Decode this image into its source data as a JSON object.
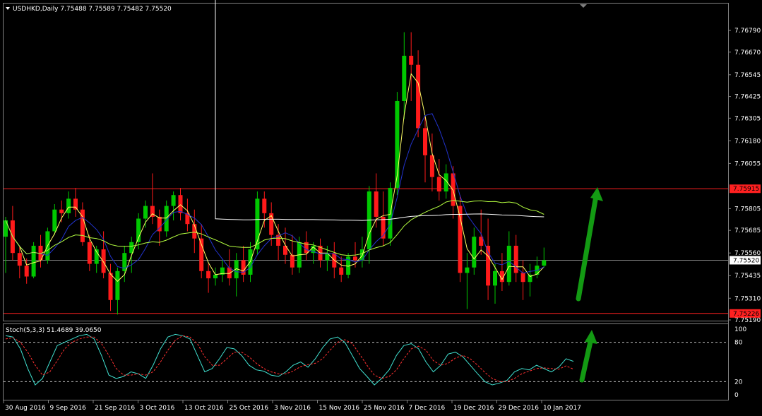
{
  "header": {
    "symbol_line": "USDHKD,Daily  7.75488 7.75589 7.75482 7.75520"
  },
  "indicator": {
    "label": "Stoch(5,3,3) 51.4689 39.0650"
  },
  "colors": {
    "background": "#000000",
    "grid": "#808080",
    "bull": "#00c800",
    "bear": "#ff1a1a",
    "ma_fast": "#ffff66",
    "ma_mid": "#2233cc",
    "ma_slow": "#b5ff40",
    "ma_long": "#ffffff",
    "stoch_main": "#40e0d0",
    "stoch_signal": "#ff3030",
    "hline": "#ff2020",
    "arrow": "#139a13"
  },
  "chart_data": {
    "type": "candlestick",
    "ylim": [
      7.7519,
      7.7688
    ],
    "y_ticks": [
      "7.76790",
      "7.76670",
      "7.76545",
      "7.76425",
      "7.76305",
      "7.76180",
      "7.76055",
      "7.75805",
      "7.75685",
      "7.75560",
      "7.75435",
      "7.75310",
      "7.75190"
    ],
    "price_labels": [
      {
        "value": 7.75915,
        "text": "7.75915",
        "style": "red"
      },
      {
        "value": 7.7552,
        "text": "7.75520",
        "style": "white"
      },
      {
        "value": 7.75226,
        "text": "7.75226",
        "style": "red"
      }
    ],
    "horizontal_lines": [
      7.75915,
      7.75226
    ],
    "current_price_line": 7.7552,
    "x_labels": [
      "30 Aug 2016",
      "9 Sep 2016",
      "21 Sep 2016",
      "3 Oct 2016",
      "13 Oct 2016",
      "25 Oct 2016",
      "3 Nov 2016",
      "15 Nov 2016",
      "25 Nov 2016",
      "7 Dec 2016",
      "19 Dec 2016",
      "29 Dec 2016",
      "10 Jan 2017"
    ],
    "candles": [
      {
        "o": 7.7565,
        "h": 7.7576,
        "l": 7.7545,
        "c": 7.7574
      },
      {
        "o": 7.7574,
        "h": 7.7582,
        "l": 7.7552,
        "c": 7.7556
      },
      {
        "o": 7.7556,
        "h": 7.756,
        "l": 7.7542,
        "c": 7.7549
      },
      {
        "o": 7.7549,
        "h": 7.7553,
        "l": 7.7539,
        "c": 7.7543
      },
      {
        "o": 7.7543,
        "h": 7.7562,
        "l": 7.7542,
        "c": 7.756
      },
      {
        "o": 7.756,
        "h": 7.7566,
        "l": 7.7548,
        "c": 7.7552
      },
      {
        "o": 7.7552,
        "h": 7.757,
        "l": 7.755,
        "c": 7.7568
      },
      {
        "o": 7.7568,
        "h": 7.7583,
        "l": 7.7566,
        "c": 7.758
      },
      {
        "o": 7.758,
        "h": 7.7585,
        "l": 7.7573,
        "c": 7.7578
      },
      {
        "o": 7.7578,
        "h": 7.759,
        "l": 7.7575,
        "c": 7.7586
      },
      {
        "o": 7.7586,
        "h": 7.7592,
        "l": 7.7576,
        "c": 7.758
      },
      {
        "o": 7.758,
        "h": 7.7584,
        "l": 7.756,
        "c": 7.7562
      },
      {
        "o": 7.7562,
        "h": 7.7566,
        "l": 7.7546,
        "c": 7.755
      },
      {
        "o": 7.755,
        "h": 7.756,
        "l": 7.7545,
        "c": 7.7558
      },
      {
        "o": 7.7558,
        "h": 7.7568,
        "l": 7.7542,
        "c": 7.7545
      },
      {
        "o": 7.7545,
        "h": 7.755,
        "l": 7.7524,
        "c": 7.753
      },
      {
        "o": 7.753,
        "h": 7.7548,
        "l": 7.7522,
        "c": 7.7546
      },
      {
        "o": 7.7546,
        "h": 7.756,
        "l": 7.754,
        "c": 7.7556
      },
      {
        "o": 7.7556,
        "h": 7.7565,
        "l": 7.7545,
        "c": 7.7562
      },
      {
        "o": 7.7562,
        "h": 7.7578,
        "l": 7.7558,
        "c": 7.7575
      },
      {
        "o": 7.7575,
        "h": 7.7585,
        "l": 7.757,
        "c": 7.7582
      },
      {
        "o": 7.7582,
        "h": 7.76,
        "l": 7.7572,
        "c": 7.7576
      },
      {
        "o": 7.7576,
        "h": 7.758,
        "l": 7.756,
        "c": 7.7568
      },
      {
        "o": 7.7568,
        "h": 7.7585,
        "l": 7.7565,
        "c": 7.7582
      },
      {
        "o": 7.7582,
        "h": 7.759,
        "l": 7.7574,
        "c": 7.7588
      },
      {
        "o": 7.7588,
        "h": 7.7592,
        "l": 7.7574,
        "c": 7.7578
      },
      {
        "o": 7.7578,
        "h": 7.7586,
        "l": 7.7568,
        "c": 7.7572
      },
      {
        "o": 7.7572,
        "h": 7.758,
        "l": 7.7556,
        "c": 7.7564
      },
      {
        "o": 7.7564,
        "h": 7.7572,
        "l": 7.7542,
        "c": 7.7546
      },
      {
        "o": 7.7546,
        "h": 7.755,
        "l": 7.7534,
        "c": 7.7542
      },
      {
        "o": 7.7542,
        "h": 7.7548,
        "l": 7.7538,
        "c": 7.7544
      },
      {
        "o": 7.7544,
        "h": 7.7552,
        "l": 7.754,
        "c": 7.7548
      },
      {
        "o": 7.7548,
        "h": 7.7558,
        "l": 7.7538,
        "c": 7.7542
      },
      {
        "o": 7.7542,
        "h": 7.7556,
        "l": 7.7532,
        "c": 7.7552
      },
      {
        "o": 7.7552,
        "h": 7.756,
        "l": 7.754,
        "c": 7.7544
      },
      {
        "o": 7.7544,
        "h": 7.7562,
        "l": 7.754,
        "c": 7.7558
      },
      {
        "o": 7.7558,
        "h": 7.759,
        "l": 7.7555,
        "c": 7.7586
      },
      {
        "o": 7.7586,
        "h": 7.759,
        "l": 7.757,
        "c": 7.7578
      },
      {
        "o": 7.7578,
        "h": 7.7584,
        "l": 7.756,
        "c": 7.7566
      },
      {
        "o": 7.7566,
        "h": 7.7572,
        "l": 7.7552,
        "c": 7.756
      },
      {
        "o": 7.756,
        "h": 7.757,
        "l": 7.755,
        "c": 7.7555
      },
      {
        "o": 7.7555,
        "h": 7.7566,
        "l": 7.7544,
        "c": 7.7548
      },
      {
        "o": 7.7548,
        "h": 7.7565,
        "l": 7.7545,
        "c": 7.7562
      },
      {
        "o": 7.7562,
        "h": 7.7568,
        "l": 7.7552,
        "c": 7.7556
      },
      {
        "o": 7.7556,
        "h": 7.7562,
        "l": 7.755,
        "c": 7.756
      },
      {
        "o": 7.756,
        "h": 7.7564,
        "l": 7.7548,
        "c": 7.7552
      },
      {
        "o": 7.7552,
        "h": 7.756,
        "l": 7.7546,
        "c": 7.7556
      },
      {
        "o": 7.7556,
        "h": 7.7562,
        "l": 7.7542,
        "c": 7.7548
      },
      {
        "o": 7.7548,
        "h": 7.7554,
        "l": 7.754,
        "c": 7.7544
      },
      {
        "o": 7.7544,
        "h": 7.7556,
        "l": 7.7542,
        "c": 7.7554
      },
      {
        "o": 7.7554,
        "h": 7.7562,
        "l": 7.7548,
        "c": 7.7552
      },
      {
        "o": 7.7552,
        "h": 7.7565,
        "l": 7.7548,
        "c": 7.7558
      },
      {
        "o": 7.7558,
        "h": 7.7593,
        "l": 7.755,
        "c": 7.759
      },
      {
        "o": 7.759,
        "h": 7.76,
        "l": 7.757,
        "c": 7.7576
      },
      {
        "o": 7.7576,
        "h": 7.759,
        "l": 7.756,
        "c": 7.7564
      },
      {
        "o": 7.7564,
        "h": 7.7595,
        "l": 7.756,
        "c": 7.7592
      },
      {
        "o": 7.7592,
        "h": 7.7645,
        "l": 7.7588,
        "c": 7.764
      },
      {
        "o": 7.764,
        "h": 7.7678,
        "l": 7.763,
        "c": 7.7665
      },
      {
        "o": 7.7665,
        "h": 7.7678,
        "l": 7.764,
        "c": 7.766
      },
      {
        "o": 7.766,
        "h": 7.7668,
        "l": 7.762,
        "c": 7.7625
      },
      {
        "o": 7.7625,
        "h": 7.7632,
        "l": 7.7595,
        "c": 7.761
      },
      {
        "o": 7.761,
        "h": 7.7622,
        "l": 7.759,
        "c": 7.7598
      },
      {
        "o": 7.7598,
        "h": 7.7608,
        "l": 7.7585,
        "c": 7.759
      },
      {
        "o": 7.759,
        "h": 7.7605,
        "l": 7.7586,
        "c": 7.76
      },
      {
        "o": 7.76,
        "h": 7.7604,
        "l": 7.7575,
        "c": 7.7582
      },
      {
        "o": 7.7582,
        "h": 7.7588,
        "l": 7.754,
        "c": 7.7545
      },
      {
        "o": 7.7545,
        "h": 7.7556,
        "l": 7.7525,
        "c": 7.7548
      },
      {
        "o": 7.7548,
        "h": 7.757,
        "l": 7.7544,
        "c": 7.7565
      },
      {
        "o": 7.7565,
        "h": 7.758,
        "l": 7.7555,
        "c": 7.756
      },
      {
        "o": 7.756,
        "h": 7.7575,
        "l": 7.753,
        "c": 7.7538
      },
      {
        "o": 7.7538,
        "h": 7.755,
        "l": 7.7528,
        "c": 7.7546
      },
      {
        "o": 7.7546,
        "h": 7.7556,
        "l": 7.7535,
        "c": 7.754
      },
      {
        "o": 7.754,
        "h": 7.7568,
        "l": 7.7538,
        "c": 7.756
      },
      {
        "o": 7.756,
        "h": 7.7566,
        "l": 7.754,
        "c": 7.7545
      },
      {
        "o": 7.7545,
        "h": 7.7552,
        "l": 7.753,
        "c": 7.754
      },
      {
        "o": 7.754,
        "h": 7.755,
        "l": 7.7532,
        "c": 7.7544
      },
      {
        "o": 7.7544,
        "h": 7.7554,
        "l": 7.7542,
        "c": 7.7549
      },
      {
        "o": 7.7549,
        "h": 7.7559,
        "l": 7.7548,
        "c": 7.7552
      }
    ],
    "stochastic": {
      "ylim": [
        0,
        100
      ],
      "levels": [
        80,
        20
      ],
      "tick_labels": [
        "100",
        "80",
        "20",
        "0"
      ],
      "main": [
        90,
        88,
        70,
        40,
        15,
        25,
        50,
        75,
        80,
        85,
        90,
        92,
        85,
        60,
        30,
        25,
        28,
        35,
        32,
        25,
        45,
        70,
        88,
        92,
        90,
        85,
        60,
        35,
        40,
        55,
        72,
        70,
        60,
        45,
        38,
        36,
        30,
        28,
        35,
        45,
        50,
        42,
        55,
        72,
        85,
        88,
        80,
        60,
        40,
        28,
        15,
        25,
        38,
        60,
        75,
        78,
        70,
        50,
        35,
        45,
        62,
        65,
        58,
        45,
        32,
        20,
        15,
        18,
        22,
        35,
        40,
        38,
        45,
        40,
        35,
        42,
        55,
        51
      ],
      "signal": [
        85,
        87,
        80,
        65,
        45,
        30,
        35,
        52,
        70,
        80,
        85,
        88,
        88,
        78,
        60,
        40,
        30,
        30,
        32,
        30,
        35,
        50,
        68,
        83,
        90,
        88,
        78,
        58,
        45,
        45,
        55,
        65,
        65,
        58,
        48,
        40,
        35,
        32,
        32,
        36,
        43,
        46,
        48,
        55,
        68,
        80,
        84,
        78,
        62,
        45,
        30,
        25,
        28,
        38,
        55,
        70,
        74,
        68,
        52,
        45,
        48,
        56,
        60,
        55,
        45,
        34,
        25,
        20,
        20,
        25,
        32,
        36,
        40,
        41,
        40,
        39,
        44,
        39
      ]
    }
  }
}
